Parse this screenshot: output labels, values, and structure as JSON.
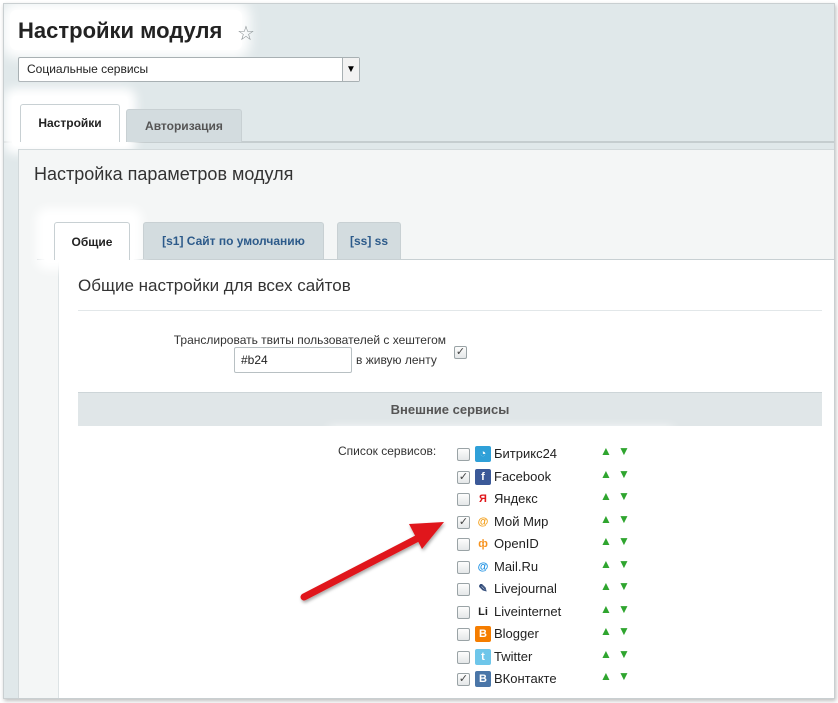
{
  "header": {
    "title": "Настройки модуля"
  },
  "module_select": {
    "value": "Социальные сервисы"
  },
  "top_tabs": [
    {
      "label": "Настройки",
      "active": true
    },
    {
      "label": "Авторизация",
      "active": false
    }
  ],
  "panel": {
    "heading": "Настройка параметров модуля"
  },
  "inner_tabs": [
    {
      "label": "Общие",
      "active": true
    },
    {
      "label": "[s1] Сайт по умолчанию",
      "active": false
    },
    {
      "label": "[ss] ss",
      "active": false
    }
  ],
  "general": {
    "title": "Общие настройки для всех сайтов",
    "twitter_label": "Транслировать твиты пользователей с хештегом",
    "hashtag_value": "#b24",
    "twitter_suffix": "в живую ленту",
    "twitter_checked": true
  },
  "external": {
    "header": "Внешние сервисы",
    "list_label": "Список сервисов:",
    "services": [
      {
        "name": "Битрикс24",
        "checked": false,
        "icon": "bitrix24-icon",
        "color": "#2fa0d8",
        "glyph": "◔"
      },
      {
        "name": "Facebook",
        "checked": true,
        "icon": "facebook-icon",
        "color": "#3b5998",
        "glyph": "f"
      },
      {
        "name": "Яндекс",
        "checked": false,
        "icon": "yandex-icon",
        "color": "#ffffff",
        "glyph": "Я"
      },
      {
        "name": "Мой Мир",
        "checked": true,
        "icon": "moimir-icon",
        "color": "#ffffff",
        "glyph": "@"
      },
      {
        "name": "OpenID",
        "checked": false,
        "icon": "openid-icon",
        "color": "#ffffff",
        "glyph": "ф"
      },
      {
        "name": "Mail.Ru",
        "checked": false,
        "icon": "mailru-icon",
        "color": "#ffffff",
        "glyph": "@"
      },
      {
        "name": "Livejournal",
        "checked": false,
        "icon": "livejournal-icon",
        "color": "#ffffff",
        "glyph": "✎"
      },
      {
        "name": "Liveinternet",
        "checked": false,
        "icon": "liveinternet-icon",
        "color": "#ffffff",
        "glyph": "Li"
      },
      {
        "name": "Blogger",
        "checked": false,
        "icon": "blogger-icon",
        "color": "#f57d00",
        "glyph": "B"
      },
      {
        "name": "Twitter",
        "checked": false,
        "icon": "twitter-icon",
        "color": "#6ec6ea",
        "glyph": "t"
      },
      {
        "name": "ВКонтакте",
        "checked": true,
        "icon": "vkontakte-icon",
        "color": "#4a76a8",
        "glyph": "B"
      }
    ]
  }
}
